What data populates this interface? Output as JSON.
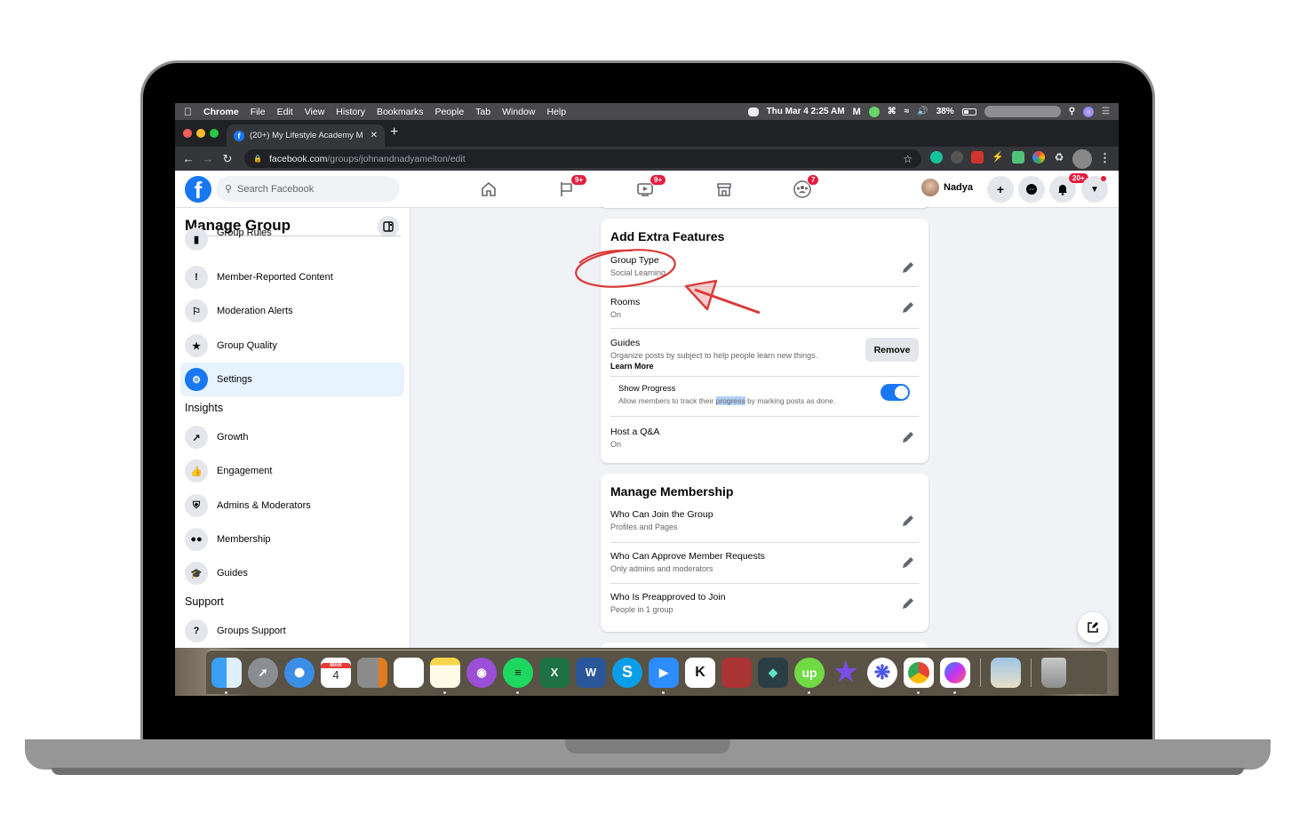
{
  "menubar": {
    "app_items": [
      "Chrome",
      "File",
      "Edit",
      "View",
      "History",
      "Bookmarks",
      "People",
      "Tab",
      "Window",
      "Help"
    ],
    "clock": "Thu Mar 4  2:25 AM",
    "battery": "38%"
  },
  "browser": {
    "tab_title": "(20+) My Lifestyle Academy M",
    "url_host": "facebook.com",
    "url_path": "/groups/johnandnadyamelton/edit"
  },
  "fb_header": {
    "search_placeholder": "Search Facebook",
    "badges": {
      "pages": "9+",
      "watch": "9+",
      "groups": "7",
      "notifications": "20+"
    },
    "user_name": "Nadya"
  },
  "sidebar": {
    "title": "Manage Group",
    "items_top": [
      {
        "label": "Group Rules",
        "icon": "book-icon"
      },
      {
        "label": "Member-Reported Content",
        "icon": "report-icon"
      },
      {
        "label": "Moderation Alerts",
        "icon": "alert-bubble-icon"
      },
      {
        "label": "Group Quality",
        "icon": "award-icon"
      },
      {
        "label": "Settings",
        "icon": "gear-icon",
        "active": true
      }
    ],
    "insights_heading": "Insights",
    "insights_items": [
      {
        "label": "Growth",
        "icon": "growth-chart-icon"
      },
      {
        "label": "Engagement",
        "icon": "thumbs-up-icon"
      },
      {
        "label": "Admins & Moderators",
        "icon": "shield-icon"
      },
      {
        "label": "Membership",
        "icon": "people-icon"
      },
      {
        "label": "Guides",
        "icon": "graduation-cap-icon"
      }
    ],
    "support_heading": "Support",
    "support_items": [
      {
        "label": "Groups Support",
        "icon": "question-icon"
      }
    ]
  },
  "extra_features": {
    "title": "Add Extra Features",
    "group_type": {
      "title": "Group Type",
      "value": "Social Learning"
    },
    "rooms": {
      "title": "Rooms",
      "value": "On"
    },
    "guides": {
      "title": "Guides",
      "description": "Organize posts by subject to help people learn new things.",
      "learn_more": "Learn More",
      "button": "Remove"
    },
    "show_progress": {
      "title": "Show Progress",
      "desc_before": "Allow members to track their ",
      "desc_highlight": "progress",
      "desc_after": " by marking posts as done.",
      "enabled": true
    },
    "qa": {
      "title": "Host a Q&A",
      "value": "On"
    }
  },
  "membership": {
    "title": "Manage Membership",
    "rows": [
      {
        "title": "Who Can Join the Group",
        "value": "Profiles and Pages"
      },
      {
        "title": "Who Can Approve Member Requests",
        "value": "Only admins and moderators"
      },
      {
        "title": "Who Is Preapproved to Join",
        "value": "People in 1 group"
      }
    ]
  },
  "dock": {
    "apps": [
      "Finder",
      "Launchpad",
      "Safari",
      "Calendar",
      "Calculator",
      "Reminders",
      "Notes",
      "Podcasts",
      "Spotify",
      "Excel",
      "Word",
      "Skype",
      "Zoom",
      "Kajabi",
      "Photo Booth",
      "Filmora",
      "Upwork",
      "iMovie",
      "Sunflower",
      "Chrome",
      "Messenger",
      "Preview",
      "Trash"
    ],
    "calendar_month": "MAR",
    "calendar_day": "4"
  },
  "colors": {
    "fb_blue": "#1877f2",
    "badge_red": "#e41e3f",
    "annotation_red": "#d93a3a"
  }
}
